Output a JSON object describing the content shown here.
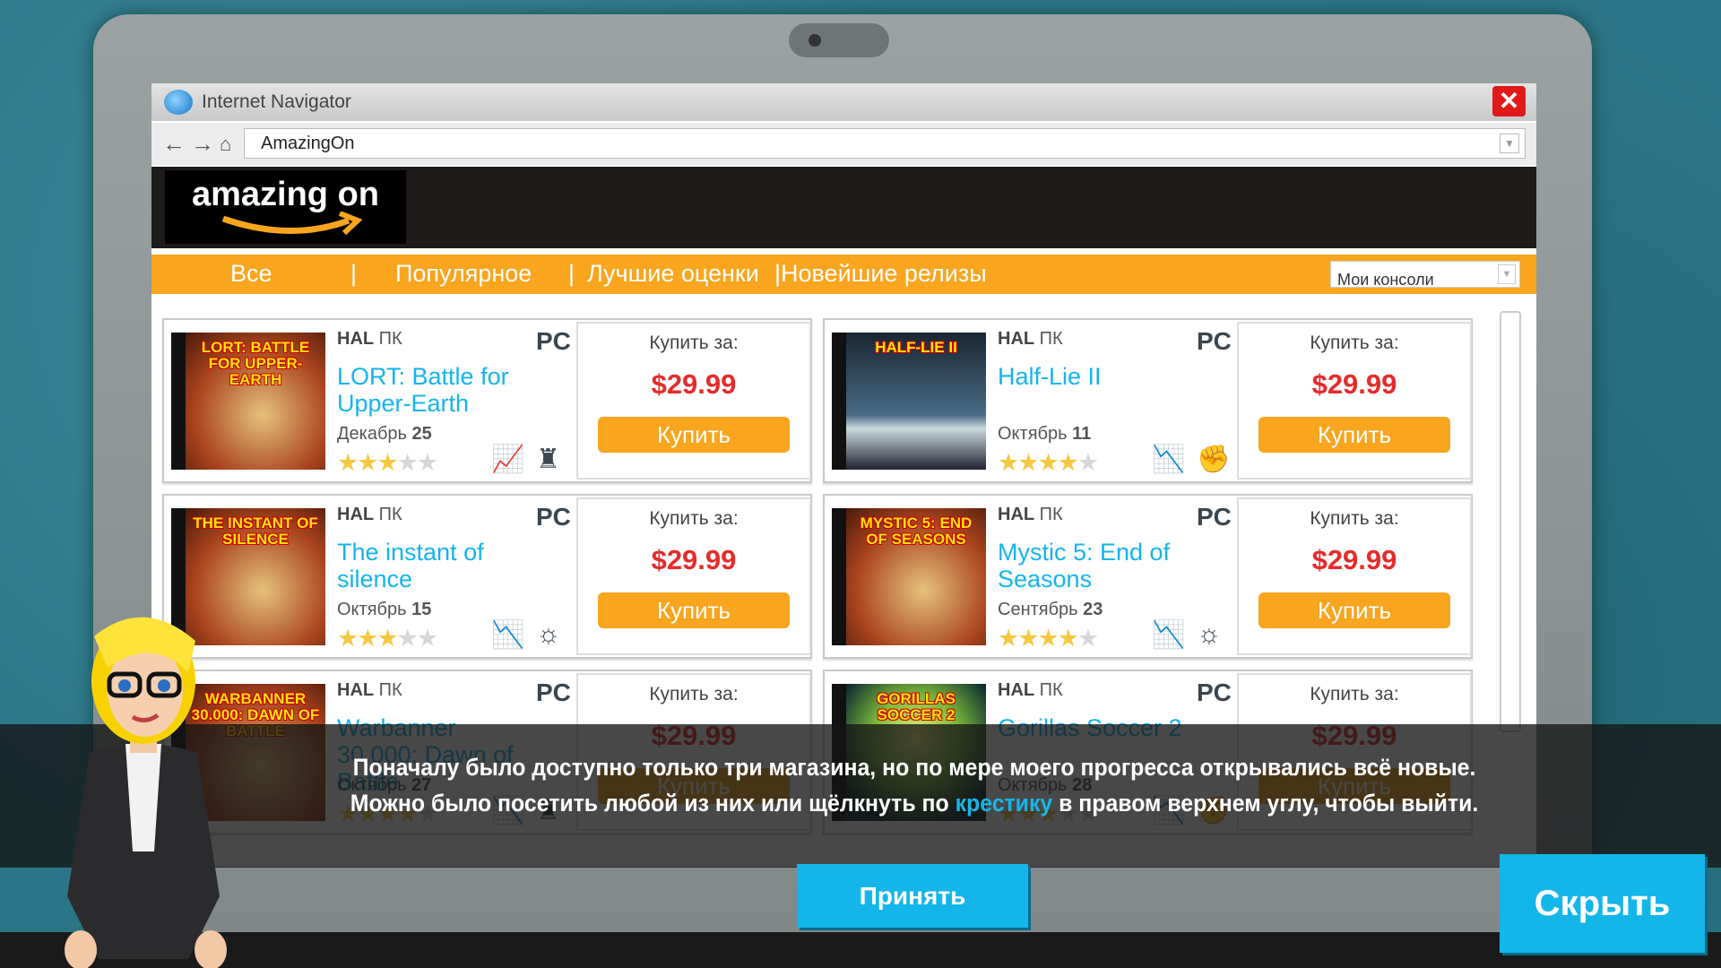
{
  "browser": {
    "title": "Internet Navigator",
    "address": "AmazingOn",
    "close_icon": "close-icon"
  },
  "store": {
    "logo": "amazing on",
    "menu": [
      "Все",
      "|",
      "Популярное",
      "|",
      "Лучшие оценки",
      "|",
      "Новейшие релизы"
    ],
    "console_select": "Мои консоли",
    "buy_label": "Купить за:",
    "buy_button": "Купить",
    "products": [
      {
        "title": "LORT: Battle for Upper-Earth",
        "cover": "LORT: BATTLE FOR UPPER-EARTH",
        "publisher": "HAL",
        "platform": "ПК",
        "badge": "PC",
        "month": "Декабрь",
        "day": "25",
        "rating": 3,
        "price": "$29.99",
        "icons": [
          "trend-up-icon",
          "rook-icon"
        ]
      },
      {
        "title": "Half-Lie II",
        "cover": "HALF-LIE II",
        "publisher": "HAL",
        "platform": "ПК",
        "badge": "PC",
        "month": "Октябрь",
        "day": "11",
        "rating": 4,
        "price": "$29.99",
        "icons": [
          "trend-down-icon",
          "fist-icon"
        ]
      },
      {
        "title": "The instant of silence",
        "cover": "THE INSTANT OF SILENCE",
        "publisher": "HAL",
        "platform": "ПК",
        "badge": "PC",
        "month": "Октябрь",
        "day": "15",
        "rating": 3,
        "price": "$29.99",
        "icons": [
          "trend-down-icon",
          "lightbulb-icon"
        ]
      },
      {
        "title": "Mystic 5: End of Seasons",
        "cover": "MYSTIC 5: END OF SEASONS",
        "publisher": "HAL",
        "platform": "ПК",
        "badge": "PC",
        "month": "Сентябрь",
        "day": "23",
        "rating": 4,
        "price": "$29.99",
        "icons": [
          "trend-down-icon",
          "lightbulb-icon"
        ]
      },
      {
        "title": "Warbanner 30.000: Dawn of Battle",
        "cover": "WARBANNER 30.000: DAWN OF BATTLE",
        "publisher": "HAL",
        "platform": "ПК",
        "badge": "PC",
        "month": "Октябрь",
        "day": "27",
        "rating": 4,
        "price": "$29.99",
        "icons": [
          "trend-down-icon",
          "rook-icon"
        ]
      },
      {
        "title": "Gorillas Soccer 2",
        "cover": "GORILLAS SOCCER 2",
        "publisher": "HAL",
        "platform": "ПК",
        "badge": "PC",
        "month": "Октябрь",
        "day": "28",
        "rating": 3,
        "price": "$29.99",
        "icons": [
          "trend-down-icon",
          "fist-icon"
        ]
      }
    ]
  },
  "dialog": {
    "text_before": "Поначалу было доступно только три магазина, но по мере моего прогресса открывались всё новые. Можно было посетить любой из них или щёлкнуть по ",
    "highlight": "крестику",
    "text_after": " в правом верхнем углу, чтобы выйти.",
    "accept": "Принять",
    "hide": "Скрыть"
  },
  "colors": {
    "accent": "#f9a51e",
    "link": "#14b4ee",
    "price": "#e62b2b",
    "button": "#14b6ea"
  }
}
